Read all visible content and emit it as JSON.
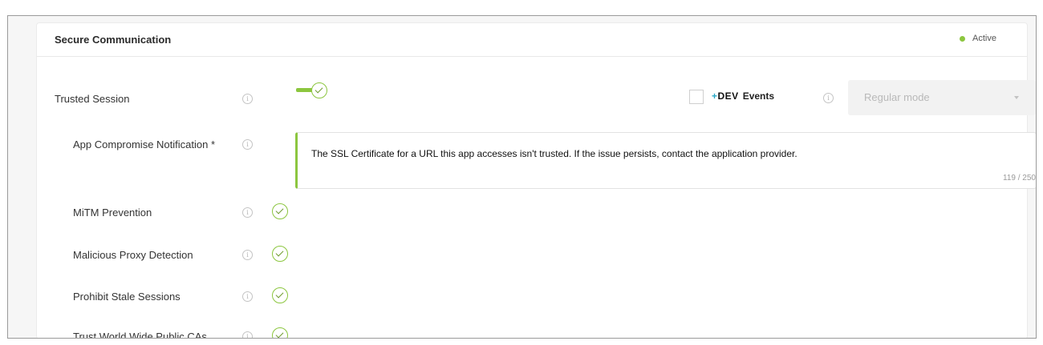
{
  "card": {
    "title": "Secure Communication",
    "status": "Active",
    "status_color": "#8cc63f"
  },
  "trusted_session": {
    "label": "Trusted Session",
    "enabled": true,
    "dev_events": {
      "logo_plus": "+",
      "logo_text": "DEV",
      "label": "Events",
      "checked": false
    },
    "mode_select": {
      "value": "Regular mode"
    }
  },
  "app_compromise_notification": {
    "label": "App Compromise Notification *",
    "message": "The SSL Certificate for a URL this app accesses isn't trusted. If the issue persists, contact the application provider.",
    "counter": "119 / 250"
  },
  "settings": [
    {
      "label": "MiTM Prevention",
      "enabled": true
    },
    {
      "label": "Malicious Proxy Detection",
      "enabled": true
    },
    {
      "label": "Prohibit Stale Sessions",
      "enabled": true
    },
    {
      "label": "Trust World Wide Public CAs",
      "enabled": true
    }
  ],
  "icons": {
    "info": "i"
  },
  "colors": {
    "accent_green": "#8cc63f",
    "dev_plus": "#26a7c6"
  }
}
